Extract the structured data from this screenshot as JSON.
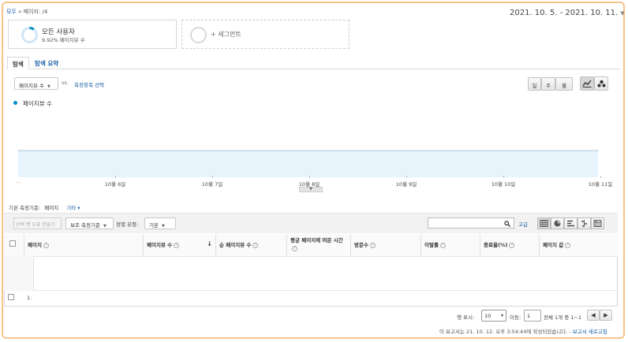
{
  "breadcrumb": {
    "root": "모두",
    "separator": "»",
    "current": "페이지: /4"
  },
  "date_range": "2021. 10. 5. - 2021. 10. 11.",
  "segments": {
    "card": {
      "title": "모든 사용자",
      "subtitle": "9.92% 페이지뷰 수",
      "percent": 9.92
    },
    "add_label": "+ 세그먼트"
  },
  "tabs": [
    {
      "label": "탐색"
    },
    {
      "label": "탐색 요약"
    }
  ],
  "controls": {
    "metric_select": "페이지뷰 수",
    "vs": "vs.",
    "compare_link": "측정항목 선택",
    "granularity": [
      "일",
      "주",
      "월"
    ],
    "legend_label": "페이지뷰 수"
  },
  "chart_data": {
    "type": "area",
    "x": [
      "10월 6일",
      "10월 7일",
      "10월 8일",
      "10월 9일",
      "10월 10일",
      "10월 11일"
    ],
    "x_left_label": "...",
    "series": [
      {
        "name": "페이지뷰 수",
        "values": [
          0,
          0,
          0,
          0,
          0,
          0,
          0
        ]
      }
    ],
    "accent": "#058dc7",
    "fill": "#e8f4fc"
  },
  "dimension": {
    "label": "기본 측정기준:",
    "value": "페이지",
    "other": "기타 ▾"
  },
  "toolbar": {
    "plot_rows": "선택 행 도표 만들기",
    "secondary_dim": "보조 측정기준",
    "sort_type_label": "정렬 유형:",
    "sort_type_value": "기본",
    "search_placeholder": "",
    "advanced": "고급"
  },
  "table": {
    "headers": [
      "페이지",
      "페이지뷰 수",
      "순 페이지뷰 수",
      "평균 페이지에 머문 시간",
      "방문수",
      "이탈률",
      "종료율(%)",
      "페이지 값"
    ],
    "rows": [
      {
        "index": "1."
      }
    ]
  },
  "pagination": {
    "rows_label": "행 표시:",
    "rows_value": "10",
    "goto_label": "이동:",
    "goto_value": "1",
    "range": "전체 1개 중 1~1"
  },
  "footer": {
    "text": "이 보고서는 21. 10. 12. 오후 3:54:44에 작성되었습니다. - ",
    "refresh": "보고서 새로고침"
  }
}
